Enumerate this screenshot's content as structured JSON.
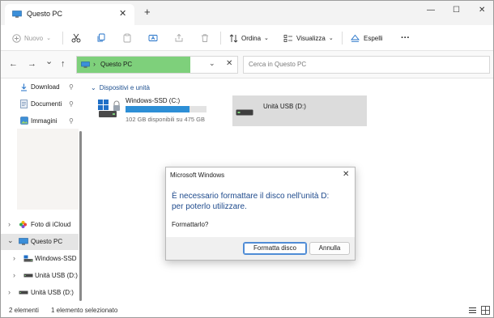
{
  "window": {
    "tab_title": "Questo PC",
    "tab_close": "✕",
    "new_tab": "+",
    "minimize": "—",
    "maximize": "☐",
    "close": "✕"
  },
  "toolbar": {
    "new_label": "Nuovo",
    "sort_label": "Ordina",
    "view_label": "Visualizza",
    "eject_label": "Espelli",
    "more_label": "···"
  },
  "nav": {
    "back": "←",
    "forward": "→",
    "recent": "⌄",
    "up": "↑",
    "breadcrumb_separator": "›",
    "location": "Questo PC",
    "address_dropdown": "⌄",
    "address_clear": "✕",
    "search_placeholder": "Cerca in Questo PC"
  },
  "sidebar": {
    "quick_access": [
      {
        "label": "Download",
        "icon": "download-icon"
      },
      {
        "label": "Documenti",
        "icon": "documents-icon"
      },
      {
        "label": "Immagini",
        "icon": "pictures-icon"
      }
    ],
    "pin_glyph": "📌",
    "tree": [
      {
        "label": "Foto di iCloud",
        "icon": "icloud-photos-icon"
      },
      {
        "label": "Questo PC",
        "icon": "pc-icon"
      },
      {
        "label": "Windows-SSD",
        "icon": "drive-icon"
      },
      {
        "label": "Unità USB (D:)",
        "icon": "usb-drive-icon"
      },
      {
        "label": "Unità USB (D:)",
        "icon": "usb-drive-icon"
      }
    ],
    "expand_glyph": "›",
    "collapse_glyph": "⌄"
  },
  "content": {
    "group_header": "Dispositivi e unità",
    "group_chevron": "⌄",
    "drives": [
      {
        "name": "Windows-SSD (C:)",
        "info": "102 GB disponibili su 475 GB",
        "used_fraction": 0.785
      },
      {
        "name": "Unità USB (D:)"
      }
    ]
  },
  "status": {
    "items_count": "2 elementi",
    "selected": "1 elemento selezionato"
  },
  "dialog": {
    "title": "Microsoft Windows",
    "close": "✕",
    "message_line1": "È necessario formattare il disco nell'unità D:",
    "message_line2": "per poterlo utilizzare.",
    "question": "Formattarlo?",
    "format_button": "Formatta disco",
    "cancel_button": "Annulla"
  },
  "colors": {
    "accent": "#0f6cbd",
    "address_highlight": "#7ed07b",
    "usage_bar": "#2d8fd6",
    "dialog_message": "#1e4a8c"
  }
}
